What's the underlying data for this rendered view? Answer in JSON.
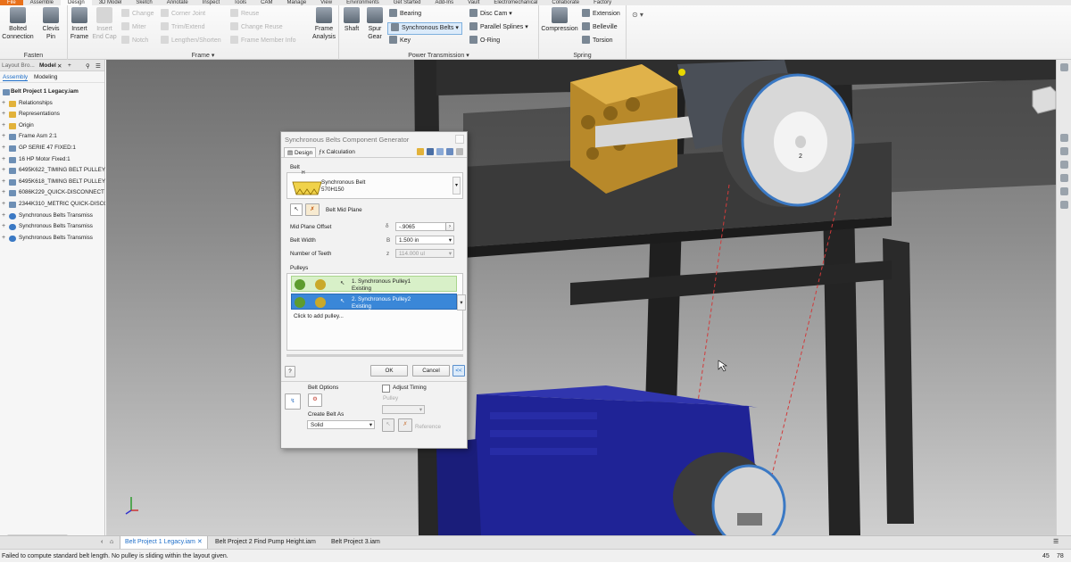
{
  "ribbon": {
    "tabs": [
      "File",
      "Assemble",
      "Design",
      "3D Model",
      "Sketch",
      "Annotate",
      "Inspect",
      "Tools",
      "CAM",
      "Manage",
      "View",
      "Environments",
      "Get Started",
      "Add-Ins",
      "Vault",
      "Electromechanical",
      "Collaborate",
      "Factory"
    ],
    "active_tab": "Design",
    "fasten": {
      "title": "Fasten",
      "bolted_connection_l1": "Bolted",
      "bolted_connection_l2": "Connection",
      "clevis_pin_l1": "Clevis",
      "clevis_pin_l2": "Pin"
    },
    "frame": {
      "title": "Frame",
      "insert_frame_l1": "Insert",
      "insert_frame_l2": "Frame",
      "insert_end_cap_l1": "Insert",
      "insert_end_cap_l2": "End Cap",
      "change": "Change",
      "miter": "Miter",
      "notch": "Notch",
      "corner_joint": "Corner Joint",
      "trim_extend": "Trim/Extend",
      "lengthen_shorten": "Lengthen/Shorten",
      "reuse": "Reuse",
      "change_reuse": "Change Reuse",
      "frame_member_info": "Frame Member Info",
      "frame_analysis_l1": "Frame",
      "frame_analysis_l2": "Analysis"
    },
    "power_transmission": {
      "title": "Power Transmission",
      "shaft": "Shaft",
      "spur_gear_l1": "Spur",
      "spur_gear_l2": "Gear",
      "bearing": "Bearing",
      "synchronous_belts": "Synchronous Belts",
      "key": "Key",
      "disc_cam": "Disc Cam",
      "parallel_splines": "Parallel Splines",
      "o_ring": "O-Ring"
    },
    "spring": {
      "title": "Spring",
      "compression": "Compression",
      "extension": "Extension",
      "belleville": "Belleville",
      "torsion": "Torsion"
    }
  },
  "browser": {
    "header_tab": "Layout Bro...",
    "model_tab": "Model",
    "subtabs": [
      "Assembly",
      "Modeling"
    ],
    "root": "Belt Project 1 Legacy.iam",
    "nodes": [
      {
        "label": "Relationships",
        "icon": "folder-icon",
        "color": "#e2b23a"
      },
      {
        "label": "Representations",
        "icon": "folder-icon",
        "color": "#e2b23a"
      },
      {
        "label": "Origin",
        "icon": "folder-icon",
        "color": "#e2b23a"
      },
      {
        "label": "Frame Asm 2:1",
        "icon": "assembly-icon",
        "color": "#6d8fb5"
      },
      {
        "label": "GP SERIE 47 FIXED:1",
        "icon": "part-icon",
        "color": "#6d8fb5"
      },
      {
        "label": "16 HP Motor Fixed:1",
        "icon": "part-icon",
        "color": "#6d8fb5"
      },
      {
        "label": "6495K622_TIMING BELT PULLEY:",
        "icon": "part-icon",
        "color": "#6d8fb5"
      },
      {
        "label": "6495K618_TIMING BELT PULLEY:",
        "icon": "part-icon",
        "color": "#6d8fb5"
      },
      {
        "label": "6086K229_QUICK-DISCONNECT B",
        "icon": "part-icon",
        "color": "#6d8fb5"
      },
      {
        "label": "2344K310_METRIC QUICK-DISCO",
        "icon": "part-icon",
        "color": "#6d8fb5"
      },
      {
        "label": "Synchronous Belts Transmiss",
        "icon": "belt-generator-icon",
        "color": "#3b79c4"
      },
      {
        "label": "Synchronous Belts Transmiss",
        "icon": "belt-generator-icon",
        "color": "#3b79c4"
      },
      {
        "label": "Synchronous Belts Transmiss",
        "icon": "belt-generator-icon",
        "color": "#3b79c4"
      }
    ]
  },
  "dialog": {
    "title": "Synchronous Belts Component Generator",
    "tabs": [
      "Design",
      "Calculation"
    ],
    "belt_section": "Belt",
    "belt_badge": "H",
    "belt_name": "Synchronous Belt",
    "belt_code": "570H150",
    "belt_mid_plane": "Belt Mid Plane",
    "mid_plane_offset_label": "Mid Plane Offset",
    "mid_plane_offset_value": "-.9065",
    "belt_width_label": "Belt Width",
    "belt_width_value": "1.500 in",
    "num_teeth_label": "Number of Teeth",
    "num_teeth_value": "114.000 ul",
    "pulleys_section": "Pulleys",
    "pulley1_name": "1. Synchronous Pulley1",
    "pulley1_state": "Existing",
    "pulley2_name": "2. Synchronous Pulley2",
    "pulley2_state": "Existing",
    "add_pulley": "Click to add pulley...",
    "ok": "OK",
    "cancel": "Cancel",
    "collapse": "<<",
    "belt_options": "Belt Options",
    "create_belt_as": "Create Belt As",
    "create_belt_as_value": "Solid",
    "adjust_timing": "Adjust Timing",
    "pulley_label": "Pulley",
    "reference": "Reference"
  },
  "viewport": {
    "pulley_label": "2"
  },
  "doc_tabs": [
    "Belt Project 1 Legacy.iam",
    "Belt Project 2 Find Pump Height.iam",
    "Belt Project 3.iam"
  ],
  "status": {
    "message": "Failed to compute standard belt length. No pulley is sliding within the layout given.",
    "count_a": "45",
    "count_b": "78"
  },
  "colors": {
    "accent_blue": "#3b79c4",
    "file_tab": "#e8701a",
    "pulley_row_green": "#d8f0c8",
    "pulley_row_selected": "#3a87d8",
    "motor_blue": "#1c1f8c",
    "pump_gold": "#c99a2c"
  }
}
